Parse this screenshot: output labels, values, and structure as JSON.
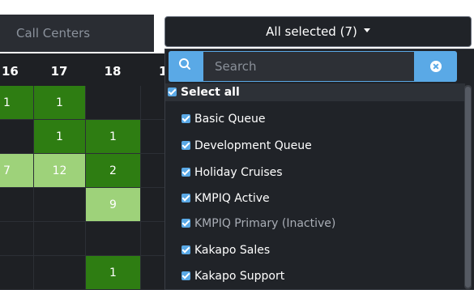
{
  "header": {
    "call_centers_label": "Call Centers",
    "select_button_label": "All selected (7)"
  },
  "table": {
    "columns": [
      "16",
      "17",
      "18",
      "1"
    ],
    "rows": [
      [
        "1",
        "1",
        "",
        ""
      ],
      [
        "",
        "1",
        "1",
        ""
      ],
      [
        "7",
        "12",
        "2",
        ""
      ],
      [
        "",
        "",
        "9",
        ""
      ],
      [
        "",
        "",
        "",
        ""
      ],
      [
        "",
        "",
        "1",
        ""
      ]
    ],
    "colors": {
      "dark_green": "#2e7d12",
      "light_green": "#9ed27a",
      "background": "#1e2024"
    }
  },
  "dropdown": {
    "search_placeholder": "Search",
    "select_all_label": "Select all",
    "options": [
      {
        "label": "Basic Queue",
        "checked": true,
        "inactive": false
      },
      {
        "label": "Development Queue",
        "checked": true,
        "inactive": false
      },
      {
        "label": "Holiday Cruises",
        "checked": true,
        "inactive": false
      },
      {
        "label": "KMPIQ Active",
        "checked": true,
        "inactive": false
      },
      {
        "label": "KMPIQ Primary (Inactive)",
        "checked": true,
        "inactive": true
      },
      {
        "label": "Kakapo Sales",
        "checked": true,
        "inactive": false
      },
      {
        "label": "Kakapo Support",
        "checked": true,
        "inactive": false
      }
    ],
    "accent_color": "#5aa9e6",
    "icons": {
      "search": "search-icon",
      "clear": "clear-icon",
      "caret": "caret-down-icon"
    }
  }
}
